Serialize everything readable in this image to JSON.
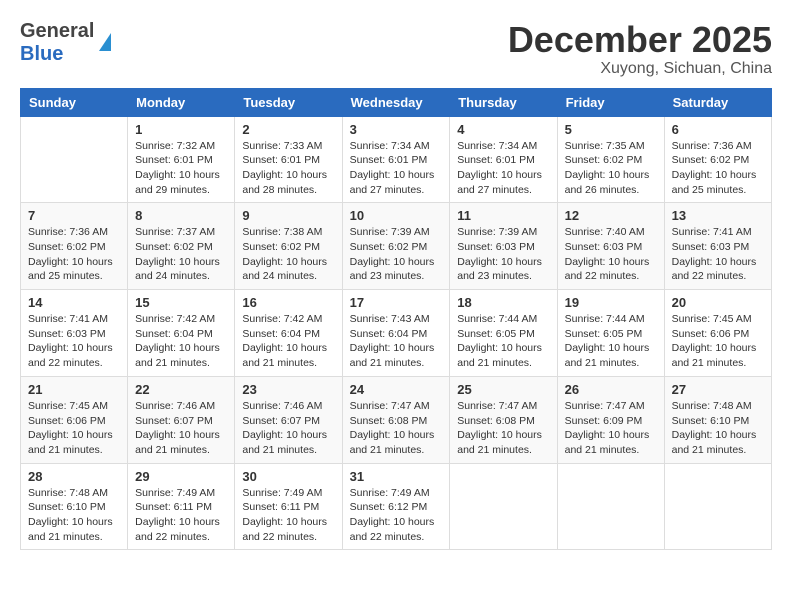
{
  "header": {
    "logo_general": "General",
    "logo_blue": "Blue",
    "month_year": "December 2025",
    "location": "Xuyong, Sichuan, China"
  },
  "calendar": {
    "days_of_week": [
      "Sunday",
      "Monday",
      "Tuesday",
      "Wednesday",
      "Thursday",
      "Friday",
      "Saturday"
    ],
    "weeks": [
      [
        {
          "day": "",
          "info": ""
        },
        {
          "day": "1",
          "info": "Sunrise: 7:32 AM\nSunset: 6:01 PM\nDaylight: 10 hours\nand 29 minutes."
        },
        {
          "day": "2",
          "info": "Sunrise: 7:33 AM\nSunset: 6:01 PM\nDaylight: 10 hours\nand 28 minutes."
        },
        {
          "day": "3",
          "info": "Sunrise: 7:34 AM\nSunset: 6:01 PM\nDaylight: 10 hours\nand 27 minutes."
        },
        {
          "day": "4",
          "info": "Sunrise: 7:34 AM\nSunset: 6:01 PM\nDaylight: 10 hours\nand 27 minutes."
        },
        {
          "day": "5",
          "info": "Sunrise: 7:35 AM\nSunset: 6:02 PM\nDaylight: 10 hours\nand 26 minutes."
        },
        {
          "day": "6",
          "info": "Sunrise: 7:36 AM\nSunset: 6:02 PM\nDaylight: 10 hours\nand 25 minutes."
        }
      ],
      [
        {
          "day": "7",
          "info": "Sunrise: 7:36 AM\nSunset: 6:02 PM\nDaylight: 10 hours\nand 25 minutes."
        },
        {
          "day": "8",
          "info": "Sunrise: 7:37 AM\nSunset: 6:02 PM\nDaylight: 10 hours\nand 24 minutes."
        },
        {
          "day": "9",
          "info": "Sunrise: 7:38 AM\nSunset: 6:02 PM\nDaylight: 10 hours\nand 24 minutes."
        },
        {
          "day": "10",
          "info": "Sunrise: 7:39 AM\nSunset: 6:02 PM\nDaylight: 10 hours\nand 23 minutes."
        },
        {
          "day": "11",
          "info": "Sunrise: 7:39 AM\nSunset: 6:03 PM\nDaylight: 10 hours\nand 23 minutes."
        },
        {
          "day": "12",
          "info": "Sunrise: 7:40 AM\nSunset: 6:03 PM\nDaylight: 10 hours\nand 22 minutes."
        },
        {
          "day": "13",
          "info": "Sunrise: 7:41 AM\nSunset: 6:03 PM\nDaylight: 10 hours\nand 22 minutes."
        }
      ],
      [
        {
          "day": "14",
          "info": "Sunrise: 7:41 AM\nSunset: 6:03 PM\nDaylight: 10 hours\nand 22 minutes."
        },
        {
          "day": "15",
          "info": "Sunrise: 7:42 AM\nSunset: 6:04 PM\nDaylight: 10 hours\nand 21 minutes."
        },
        {
          "day": "16",
          "info": "Sunrise: 7:42 AM\nSunset: 6:04 PM\nDaylight: 10 hours\nand 21 minutes."
        },
        {
          "day": "17",
          "info": "Sunrise: 7:43 AM\nSunset: 6:04 PM\nDaylight: 10 hours\nand 21 minutes."
        },
        {
          "day": "18",
          "info": "Sunrise: 7:44 AM\nSunset: 6:05 PM\nDaylight: 10 hours\nand 21 minutes."
        },
        {
          "day": "19",
          "info": "Sunrise: 7:44 AM\nSunset: 6:05 PM\nDaylight: 10 hours\nand 21 minutes."
        },
        {
          "day": "20",
          "info": "Sunrise: 7:45 AM\nSunset: 6:06 PM\nDaylight: 10 hours\nand 21 minutes."
        }
      ],
      [
        {
          "day": "21",
          "info": "Sunrise: 7:45 AM\nSunset: 6:06 PM\nDaylight: 10 hours\nand 21 minutes."
        },
        {
          "day": "22",
          "info": "Sunrise: 7:46 AM\nSunset: 6:07 PM\nDaylight: 10 hours\nand 21 minutes."
        },
        {
          "day": "23",
          "info": "Sunrise: 7:46 AM\nSunset: 6:07 PM\nDaylight: 10 hours\nand 21 minutes."
        },
        {
          "day": "24",
          "info": "Sunrise: 7:47 AM\nSunset: 6:08 PM\nDaylight: 10 hours\nand 21 minutes."
        },
        {
          "day": "25",
          "info": "Sunrise: 7:47 AM\nSunset: 6:08 PM\nDaylight: 10 hours\nand 21 minutes."
        },
        {
          "day": "26",
          "info": "Sunrise: 7:47 AM\nSunset: 6:09 PM\nDaylight: 10 hours\nand 21 minutes."
        },
        {
          "day": "27",
          "info": "Sunrise: 7:48 AM\nSunset: 6:10 PM\nDaylight: 10 hours\nand 21 minutes."
        }
      ],
      [
        {
          "day": "28",
          "info": "Sunrise: 7:48 AM\nSunset: 6:10 PM\nDaylight: 10 hours\nand 21 minutes."
        },
        {
          "day": "29",
          "info": "Sunrise: 7:49 AM\nSunset: 6:11 PM\nDaylight: 10 hours\nand 22 minutes."
        },
        {
          "day": "30",
          "info": "Sunrise: 7:49 AM\nSunset: 6:11 PM\nDaylight: 10 hours\nand 22 minutes."
        },
        {
          "day": "31",
          "info": "Sunrise: 7:49 AM\nSunset: 6:12 PM\nDaylight: 10 hours\nand 22 minutes."
        },
        {
          "day": "",
          "info": ""
        },
        {
          "day": "",
          "info": ""
        },
        {
          "day": "",
          "info": ""
        }
      ]
    ]
  }
}
